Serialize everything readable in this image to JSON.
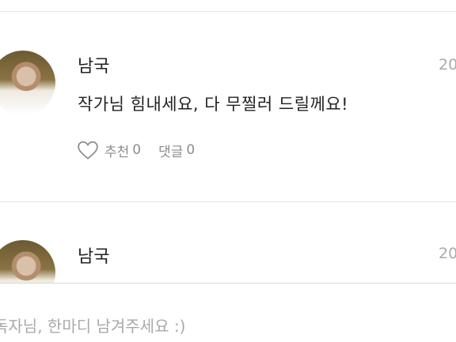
{
  "comments": [
    {
      "author": "남국",
      "date": "20",
      "text": "작가님  힘내세요, 다 무찔러 드릴께요!",
      "like_label": "추천",
      "like_count": "0",
      "reply_label": "댓글",
      "reply_count": "0",
      "icon": "heart-outline-icon"
    },
    {
      "author": "남국",
      "date": "20"
    }
  ],
  "input": {
    "placeholder": "독자님, 한마디 남겨주세요 :)"
  },
  "colors": {
    "muted": "#8c8c8c",
    "divider": "#e3e3e3"
  }
}
